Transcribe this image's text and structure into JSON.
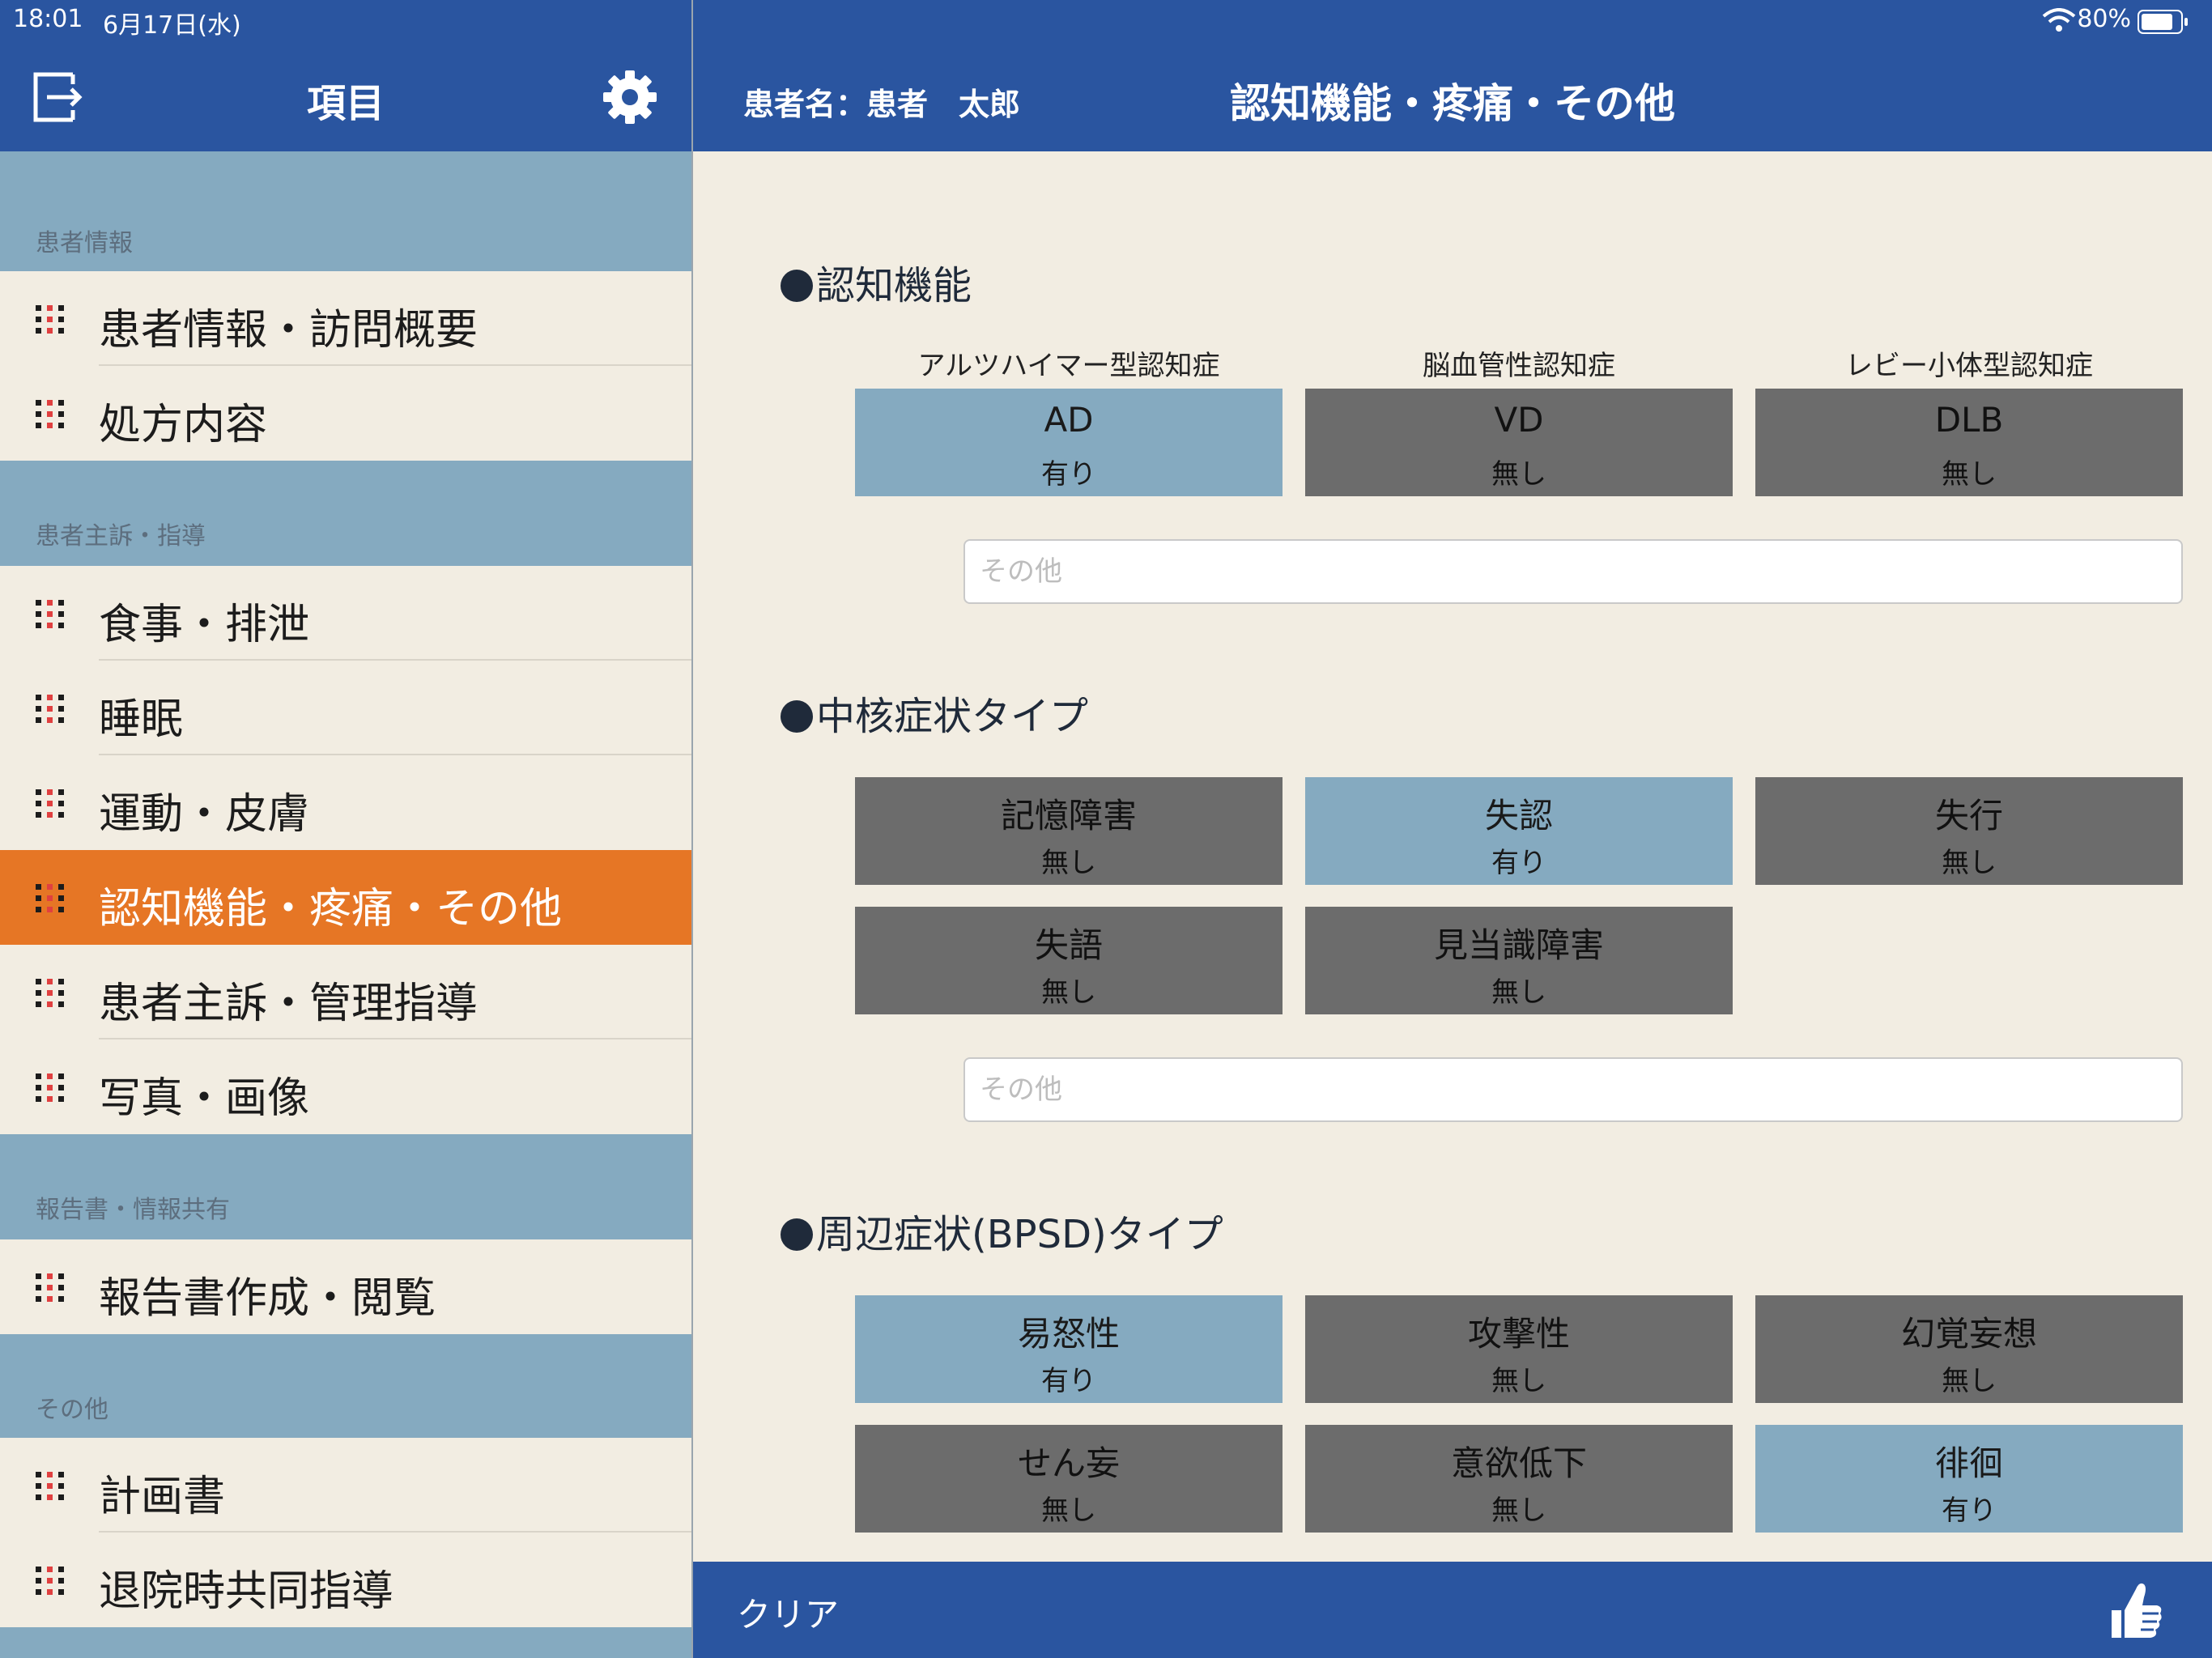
{
  "status_bar": {
    "time": "18:01",
    "date": "6月17日(水)",
    "battery": "80%"
  },
  "sidebar": {
    "title": "項目",
    "sections": [
      {
        "label": "患者情報",
        "items": [
          {
            "label": "患者情報・訪問概要"
          },
          {
            "label": "処方内容"
          }
        ]
      },
      {
        "label": "患者主訴・指導",
        "items": [
          {
            "label": "食事・排泄"
          },
          {
            "label": "睡眠"
          },
          {
            "label": "運動・皮膚"
          },
          {
            "label": "認知機能・疼痛・その他",
            "active": true
          },
          {
            "label": "患者主訴・管理指導"
          },
          {
            "label": "写真・画像"
          }
        ]
      },
      {
        "label": "報告書・情報共有",
        "items": [
          {
            "label": "報告書作成・閲覧"
          }
        ]
      },
      {
        "label": "その他",
        "items": [
          {
            "label": "計画書"
          },
          {
            "label": "退院時共同指導"
          }
        ]
      }
    ]
  },
  "header": {
    "patient_name": "患者名：患者　太郎",
    "page_title": "認知機能・疼痛・その他"
  },
  "main": {
    "cognitive": {
      "title": "認知機能",
      "captions": [
        "アルツハイマー型認知症",
        "脳血管性認知症",
        "レビー小体型認知症"
      ],
      "tiles": [
        {
          "name": "AD",
          "value": "有り",
          "on": true
        },
        {
          "name": "VD",
          "value": "無し",
          "on": false
        },
        {
          "name": "DLB",
          "value": "無し",
          "on": false
        }
      ],
      "other_placeholder": "その他"
    },
    "core": {
      "title": "中核症状タイプ",
      "tiles": [
        {
          "name": "記憶障害",
          "value": "無し",
          "on": false
        },
        {
          "name": "失認",
          "value": "有り",
          "on": true
        },
        {
          "name": "失行",
          "value": "無し",
          "on": false
        },
        {
          "name": "失語",
          "value": "無し",
          "on": false
        },
        {
          "name": "見当識障害",
          "value": "無し",
          "on": false
        }
      ],
      "other_placeholder": "その他"
    },
    "bpsd": {
      "title": "周辺症状(BPSD)タイプ",
      "tiles": [
        {
          "name": "易怒性",
          "value": "有り",
          "on": true
        },
        {
          "name": "攻撃性",
          "value": "無し",
          "on": false
        },
        {
          "name": "幻覚妄想",
          "value": "無し",
          "on": false
        },
        {
          "name": "せん妄",
          "value": "無し",
          "on": false
        },
        {
          "name": "意欲低下",
          "value": "無し",
          "on": false
        },
        {
          "name": "徘徊",
          "value": "有り",
          "on": true
        }
      ]
    }
  },
  "footer": {
    "clear_label": "クリア"
  },
  "colors": {
    "header_blue": "#2a55a0",
    "active_orange": "#e67625",
    "tile_on": "#85aac0",
    "tile_off": "#6c6c6c",
    "background": "#f2ede2"
  }
}
